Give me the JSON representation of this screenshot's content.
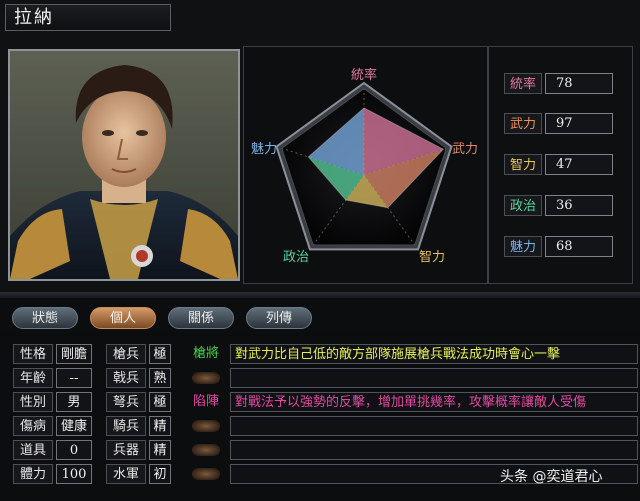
{
  "general": {
    "name": "拉納"
  },
  "radar": {
    "labels": {
      "leadership": "統率",
      "war": "武力",
      "intelligence": "智力",
      "politics": "政治",
      "charm": "魅力"
    },
    "values": {
      "leadership": 78,
      "war": 97,
      "intelligence": 47,
      "politics": 36,
      "charm": 68
    },
    "colors": {
      "leadership": "#e07aa0",
      "war": "#e08a6a",
      "intelligence": "#e0c060",
      "politics": "#5ad29e",
      "charm": "#7bb0e8"
    }
  },
  "stats": [
    {
      "label": "統率",
      "value": "78",
      "color": "#e07aa0"
    },
    {
      "label": "武力",
      "value": "97",
      "color": "#e89060"
    },
    {
      "label": "智力",
      "value": "47",
      "color": "#e8c85a"
    },
    {
      "label": "政治",
      "value": "36",
      "color": "#58d6a0"
    },
    {
      "label": "魅力",
      "value": "68",
      "color": "#7ab2ee"
    }
  ],
  "tabs": [
    {
      "label": "狀態",
      "active": false
    },
    {
      "label": "個人",
      "active": true
    },
    {
      "label": "關係",
      "active": false
    },
    {
      "label": "列傳",
      "active": false
    }
  ],
  "personal": [
    {
      "label": "性格",
      "value": "剛膽"
    },
    {
      "label": "年齡",
      "value": "--"
    },
    {
      "label": "性別",
      "value": "男"
    },
    {
      "label": "傷病",
      "value": "健康"
    },
    {
      "label": "道具",
      "value": "0"
    },
    {
      "label": "體力",
      "value": "100"
    }
  ],
  "aptitude": [
    {
      "label": "槍兵",
      "value": "極"
    },
    {
      "label": "戟兵",
      "value": "熟"
    },
    {
      "label": "弩兵",
      "value": "極"
    },
    {
      "label": "騎兵",
      "value": "精"
    },
    {
      "label": "兵器",
      "value": "精"
    },
    {
      "label": "水軍",
      "value": "初"
    }
  ],
  "skills": [
    {
      "name": "槍將",
      "desc": "對武力比自己低的敵方部隊施展槍兵戰法成功時會心一擊",
      "name_color": "#45d24a",
      "desc_color": "#e6ef5a"
    },
    {
      "name": "",
      "desc": ""
    },
    {
      "name": "陷陣",
      "desc": "對戰法予以強勢的反擊，增加單挑幾率，攻擊概率讓敵人受傷",
      "name_color": "#e04aa0",
      "desc_color": "#e04aa0"
    },
    {
      "name": "",
      "desc": ""
    },
    {
      "name": "",
      "desc": ""
    },
    {
      "name": "",
      "desc": ""
    }
  ],
  "watermark": "头条 @奕道君心"
}
